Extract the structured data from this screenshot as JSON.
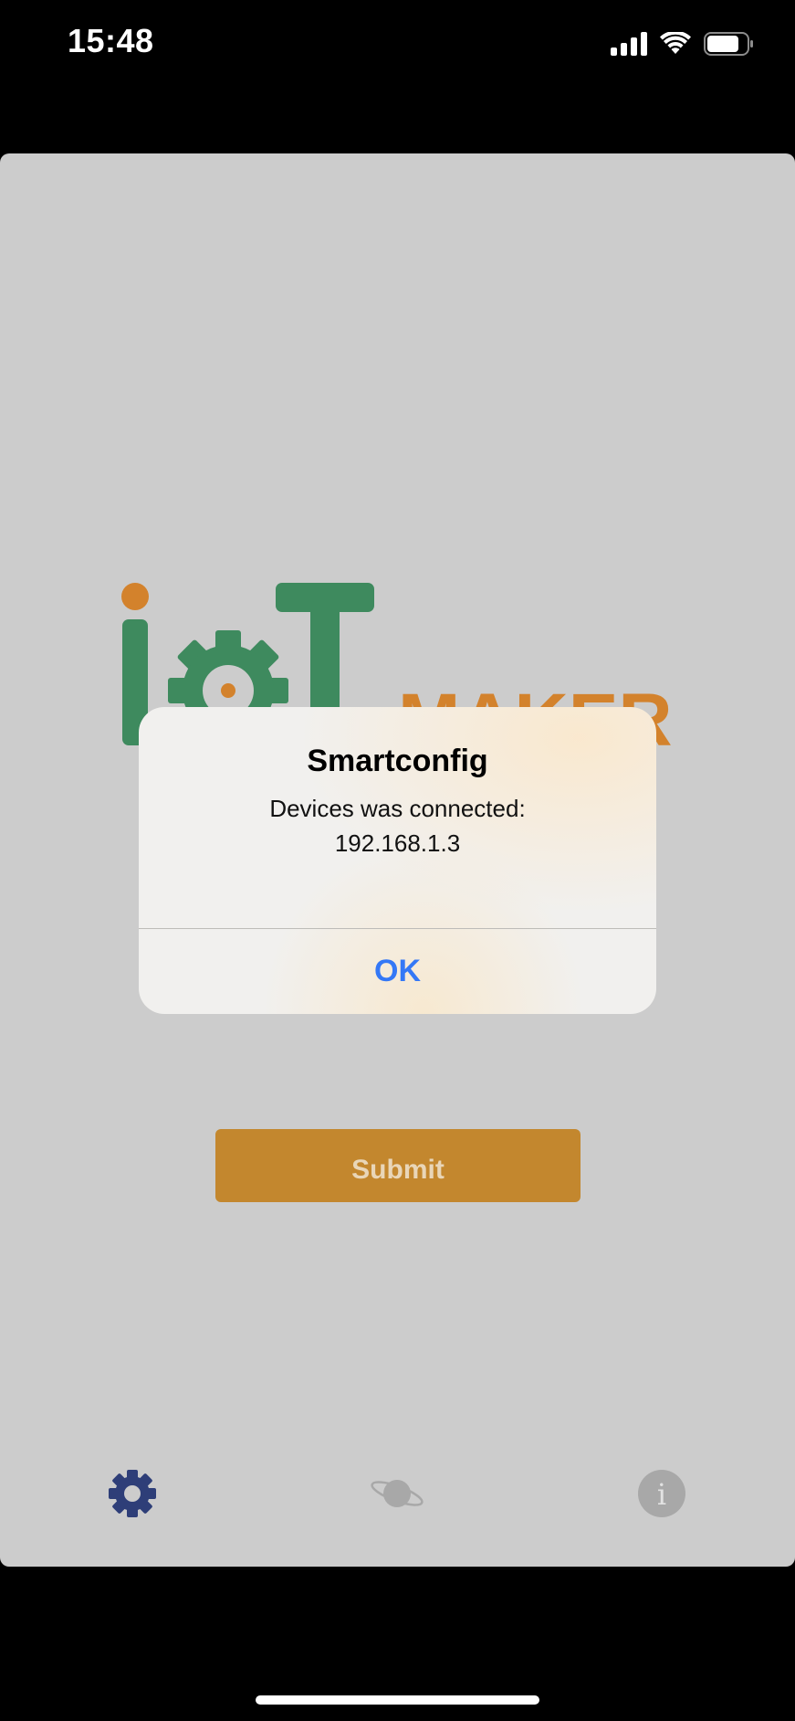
{
  "status_bar": {
    "time": "15:48",
    "icons": [
      "signal-icon",
      "wifi-icon",
      "battery-icon"
    ]
  },
  "logo": {
    "text_main": "IoT",
    "text_secondary": "MAKER",
    "colors": {
      "green": "#3e8a5e",
      "orange": "#d3822c"
    }
  },
  "form": {
    "submit_label": "Submit"
  },
  "tabbar": {
    "items": [
      {
        "icon": "gear-icon",
        "active": true
      },
      {
        "icon": "planet-icon",
        "active": false
      },
      {
        "icon": "info-icon",
        "active": false
      }
    ],
    "active_color": "#2e3e78",
    "inactive_color": "#a8a8a8"
  },
  "alert": {
    "title": "Smartconfig",
    "message": "Devices was connected:",
    "ip": "192.168.1.3",
    "ok_label": "OK",
    "button_color": "#3478f6"
  }
}
